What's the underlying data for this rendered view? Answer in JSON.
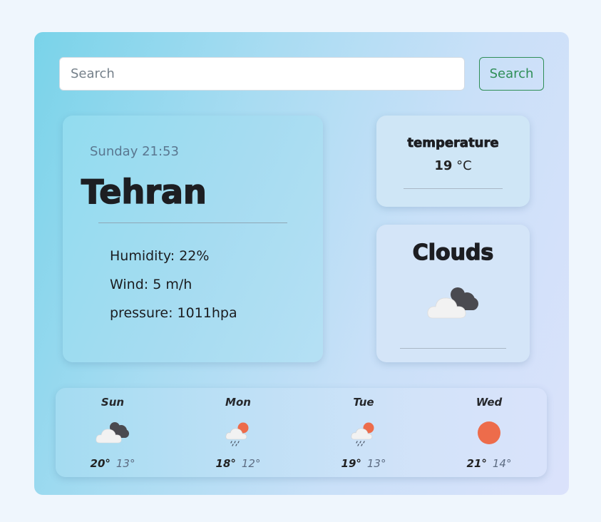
{
  "search": {
    "placeholder": "Search",
    "button_label": "Search"
  },
  "current": {
    "day_time": "Sunday 21:53",
    "city": "Tehran",
    "humidity": "Humidity: 22%",
    "wind": "Wind: 5 m/h",
    "pressure": "pressure: 1011hpa"
  },
  "temperature_card": {
    "title": "temperature",
    "value": "19",
    "unit": "°C"
  },
  "condition_card": {
    "title": "Clouds",
    "icon": "cloudy-icon"
  },
  "forecast": [
    {
      "day": "Sun",
      "high": "20°",
      "low": "13°",
      "icon": "cloudy-icon"
    },
    {
      "day": "Mon",
      "high": "18°",
      "low": "12°",
      "icon": "sun-rain-icon"
    },
    {
      "day": "Tue",
      "high": "19°",
      "low": "13°",
      "icon": "sun-rain-icon"
    },
    {
      "day": "Wed",
      "high": "21°",
      "low": "14°",
      "icon": "sun-icon"
    }
  ],
  "colors": {
    "accent_green": "#2f8e57",
    "sun": "#ed6c4b",
    "cloud_dark": "#4a4a50",
    "cloud_light": "#f2f2f2"
  }
}
